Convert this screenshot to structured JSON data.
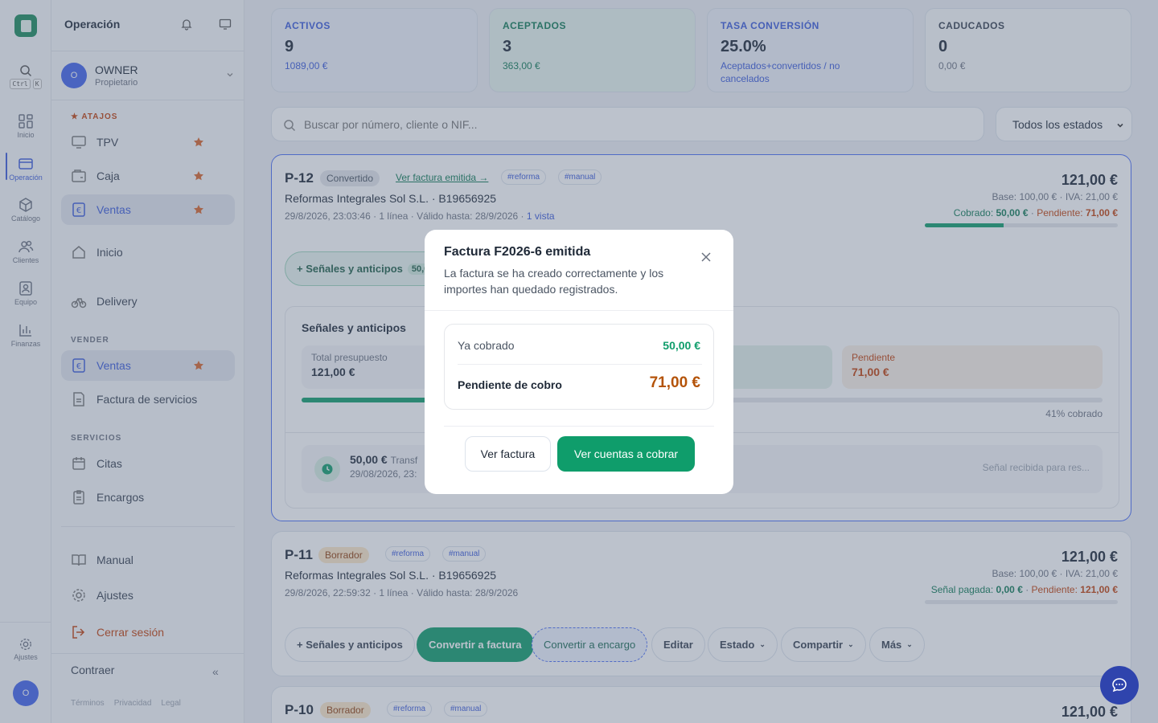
{
  "rail": {
    "search_keys": [
      "Ctrl",
      "K"
    ],
    "items": [
      {
        "label": "Inicio",
        "icon": "grid-icon"
      },
      {
        "label": "Operación",
        "icon": "card-icon"
      },
      {
        "label": "Catálogo",
        "icon": "box-icon"
      },
      {
        "label": "Clientes",
        "icon": "users-icon"
      },
      {
        "label": "Equipo",
        "icon": "badge-icon"
      },
      {
        "label": "Finanzas",
        "icon": "bar-chart-icon"
      }
    ],
    "settings_label": "Ajustes",
    "avatar_initial": "O"
  },
  "sidebar": {
    "title": "Operación",
    "owner": {
      "initial": "O",
      "name": "OWNER",
      "role": "Propietario"
    },
    "atajos_label": "ATAJOS",
    "shortcuts": [
      {
        "label": "TPV"
      },
      {
        "label": "Caja"
      },
      {
        "label": "Ventas"
      }
    ],
    "inicio_label": "Inicio",
    "delivery_label": "Delivery",
    "vender_label": "VENDER",
    "vender_items": [
      {
        "label": "Ventas"
      },
      {
        "label": "Factura de servicios"
      }
    ],
    "servicios_label": "SERVICIOS",
    "servicios_items": [
      {
        "label": "Citas"
      },
      {
        "label": "Encargos"
      }
    ],
    "manual_label": "Manual",
    "ajustes_label": "Ajustes",
    "logout_label": "Cerrar sesión",
    "contraer_label": "Contraer",
    "footer_links": [
      "Términos",
      "Privacidad",
      "Legal"
    ]
  },
  "kpis": [
    {
      "label": "ACTIVOS",
      "value": "9",
      "sub": "1089,00 €",
      "color": "#3b5bdb"
    },
    {
      "label": "ACEPTADOS",
      "value": "3",
      "sub": "363,00 €",
      "color": "#0f9d6b"
    },
    {
      "label": "TASA CONVERSIÓN",
      "value": "25.0%",
      "sub": "Aceptados+convertidos / no cancelados",
      "color": "#3b5bdb"
    },
    {
      "label": "CADUCADOS",
      "value": "0",
      "sub": "0,00 €",
      "color": "#374151"
    }
  ],
  "search": {
    "placeholder": "Buscar por número, cliente o NIF..."
  },
  "status_filter": "Todos los estados",
  "quotes": [
    {
      "code": "P-12",
      "status": "Convertido",
      "link": "Ver factura emitida →",
      "tags": [
        "#reforma",
        "#manual"
      ],
      "client": "Reformas Integrales Sol S.L. · B19656925",
      "meta": "29/8/2026, 23:03:46 · 1 línea · Válido hasta: 28/9/2026 ·",
      "views": "1 vista",
      "total": "121,00 €",
      "base": "Base: 100,00 € · IVA: 21,00 €",
      "paid_label": "Cobrado:",
      "paid_value": "50,00 €",
      "pending_label": "Pendiente:",
      "pending_value": "71,00 €",
      "progress": 0.41
    },
    {
      "code": "P-11",
      "status": "Borrador",
      "tags": [
        "#reforma",
        "#manual"
      ],
      "client": "Reformas Integrales Sol S.L. · B19656925",
      "meta": "29/8/2026, 22:59:32 · 1 línea · Válido hasta: 28/9/2026",
      "total": "121,00 €",
      "base": "Base: 100,00 € · IVA: 21,00 €",
      "paid_label": "Señal pagada:",
      "paid_value": "0,00 €",
      "pending_label": "Pendiente:",
      "pending_value": "121,00 €",
      "progress": 0,
      "actions": {
        "advances": "+ Señales y anticipos",
        "invoice": "Convertir a factura",
        "order": "Convertir a encargo",
        "edit": "Editar",
        "state": "Estado",
        "share": "Compartir",
        "more": "Más"
      }
    },
    {
      "code": "P-10",
      "status": "Borrador",
      "tags": [
        "#reforma",
        "#manual"
      ],
      "total": "121,00 €"
    }
  ],
  "advances_panel": {
    "button": "+ Señales y anticipos",
    "chip": "50,0",
    "title": "Señales y anticipos",
    "total_label": "Total presupuesto",
    "total_value": "121,00 €",
    "pending_label": "Pendiente",
    "pending_value": "71,00 €",
    "percent_label": "41% cobrado",
    "payment_amount": "50,00 €",
    "payment_method": "Transf",
    "payment_date": "29/08/2026, 23:",
    "payment_note": "Señal recibida para res..."
  },
  "modal": {
    "title": "Factura F2026-6 emitida",
    "description": "La factura se ha creado correctamente y los importes han quedado registrados.",
    "collected_label": "Ya cobrado",
    "collected_value": "50,00 €",
    "pending_label": "Pendiente de cobro",
    "pending_value": "71,00 €",
    "view_invoice": "Ver factura",
    "view_receivables": "Ver cuentas a cobrar"
  }
}
